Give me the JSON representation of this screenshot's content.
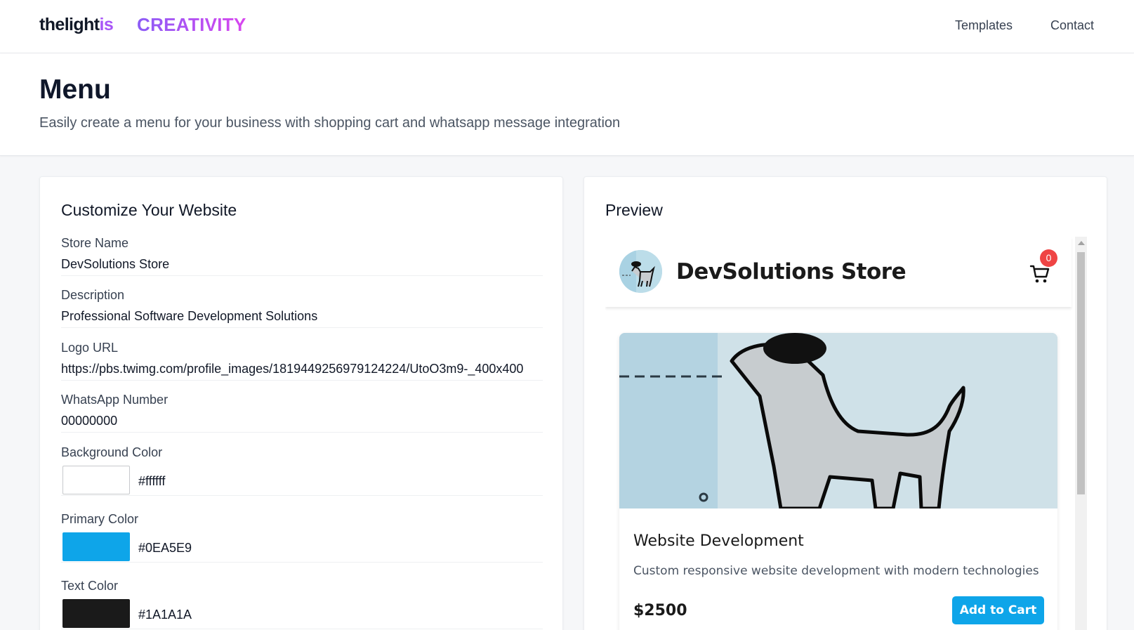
{
  "nav": {
    "brand_main": "thelight",
    "brand_accent": "is",
    "creativity": "CREATIVITY",
    "links": [
      "Templates",
      "Contact"
    ]
  },
  "hero": {
    "title": "Menu",
    "subtitle": "Easily create a menu for your business with shopping cart and whatsapp message integration"
  },
  "form": {
    "title": "Customize Your Website",
    "store_name": {
      "label": "Store Name",
      "value": "DevSolutions Store"
    },
    "description": {
      "label": "Description",
      "value": "Professional Software Development Solutions"
    },
    "logo_url": {
      "label": "Logo URL",
      "value": "https://pbs.twimg.com/profile_images/1819449256979124224/UtoO3m9-_400x400"
    },
    "whatsapp": {
      "label": "WhatsApp Number",
      "value": "00000000"
    },
    "background_color": {
      "label": "Background Color",
      "value": "#ffffff"
    },
    "primary_color": {
      "label": "Primary Color",
      "value": "#0EA5E9"
    },
    "text_color": {
      "label": "Text Color",
      "value": "#1A1A1A"
    }
  },
  "preview": {
    "title": "Preview",
    "store_name": "DevSolutions Store",
    "cart_count": "0",
    "product": {
      "name": "Website Development",
      "description": "Custom responsive website development with modern technologies",
      "price": "$2500",
      "button": "Add to Cart"
    }
  },
  "icons": {
    "cart": "shopping-cart-icon",
    "scroll_up": "scroll-up-arrow-icon"
  },
  "colors": {
    "brand_accent": "#a855f7",
    "primary": "#0EA5E9",
    "badge": "#ef4444"
  }
}
